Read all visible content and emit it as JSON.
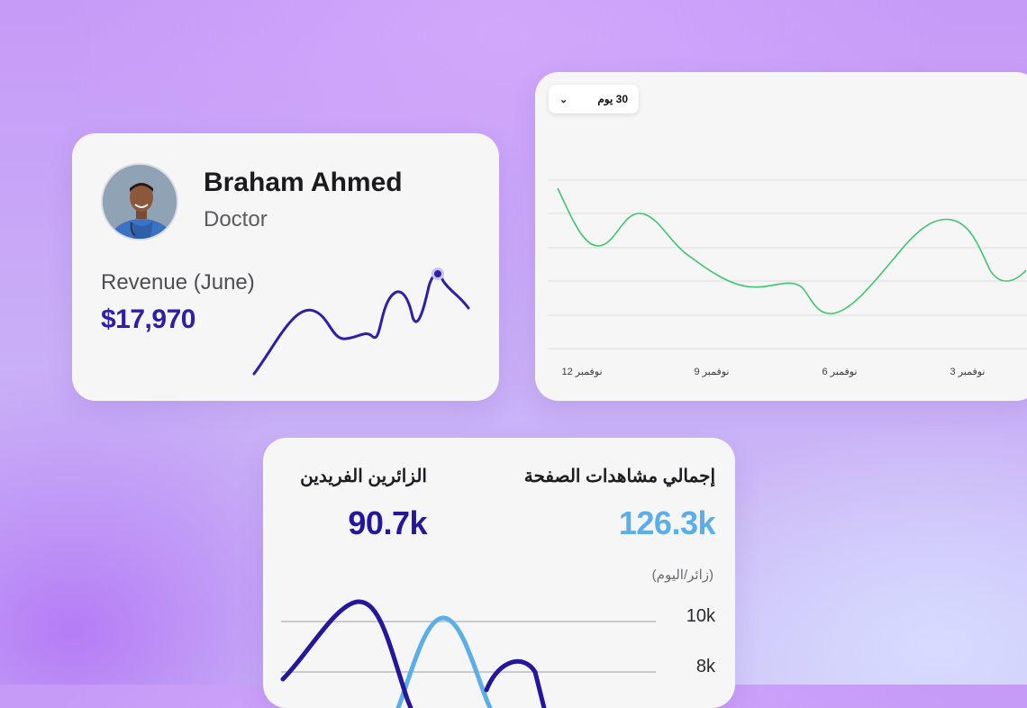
{
  "profile": {
    "name": "Braham Ahmed",
    "role": "Doctor",
    "revenue_label": "Revenue (June)",
    "revenue_value": "$17,970",
    "accent": "#2d1fa8"
  },
  "trend": {
    "range_label": "30 يوم",
    "x_ticks": [
      "12 نوفمبر",
      "9 نوفمبر",
      "6 نوفمبر",
      "3 نوفمبر"
    ],
    "line_color": "#3cc76a"
  },
  "stats": {
    "pageviews_label": "إجمالي مشاهدات الصفحة",
    "pageviews_value": "126.3k",
    "pageviews_color": "#5aaeea",
    "visitors_label": "الزائرين الفريدين",
    "visitors_value": "90.7k",
    "visitors_color": "#25179c",
    "unit_label": "(زائر/اليوم)",
    "y_ticks": [
      "10k",
      "8k"
    ]
  }
}
